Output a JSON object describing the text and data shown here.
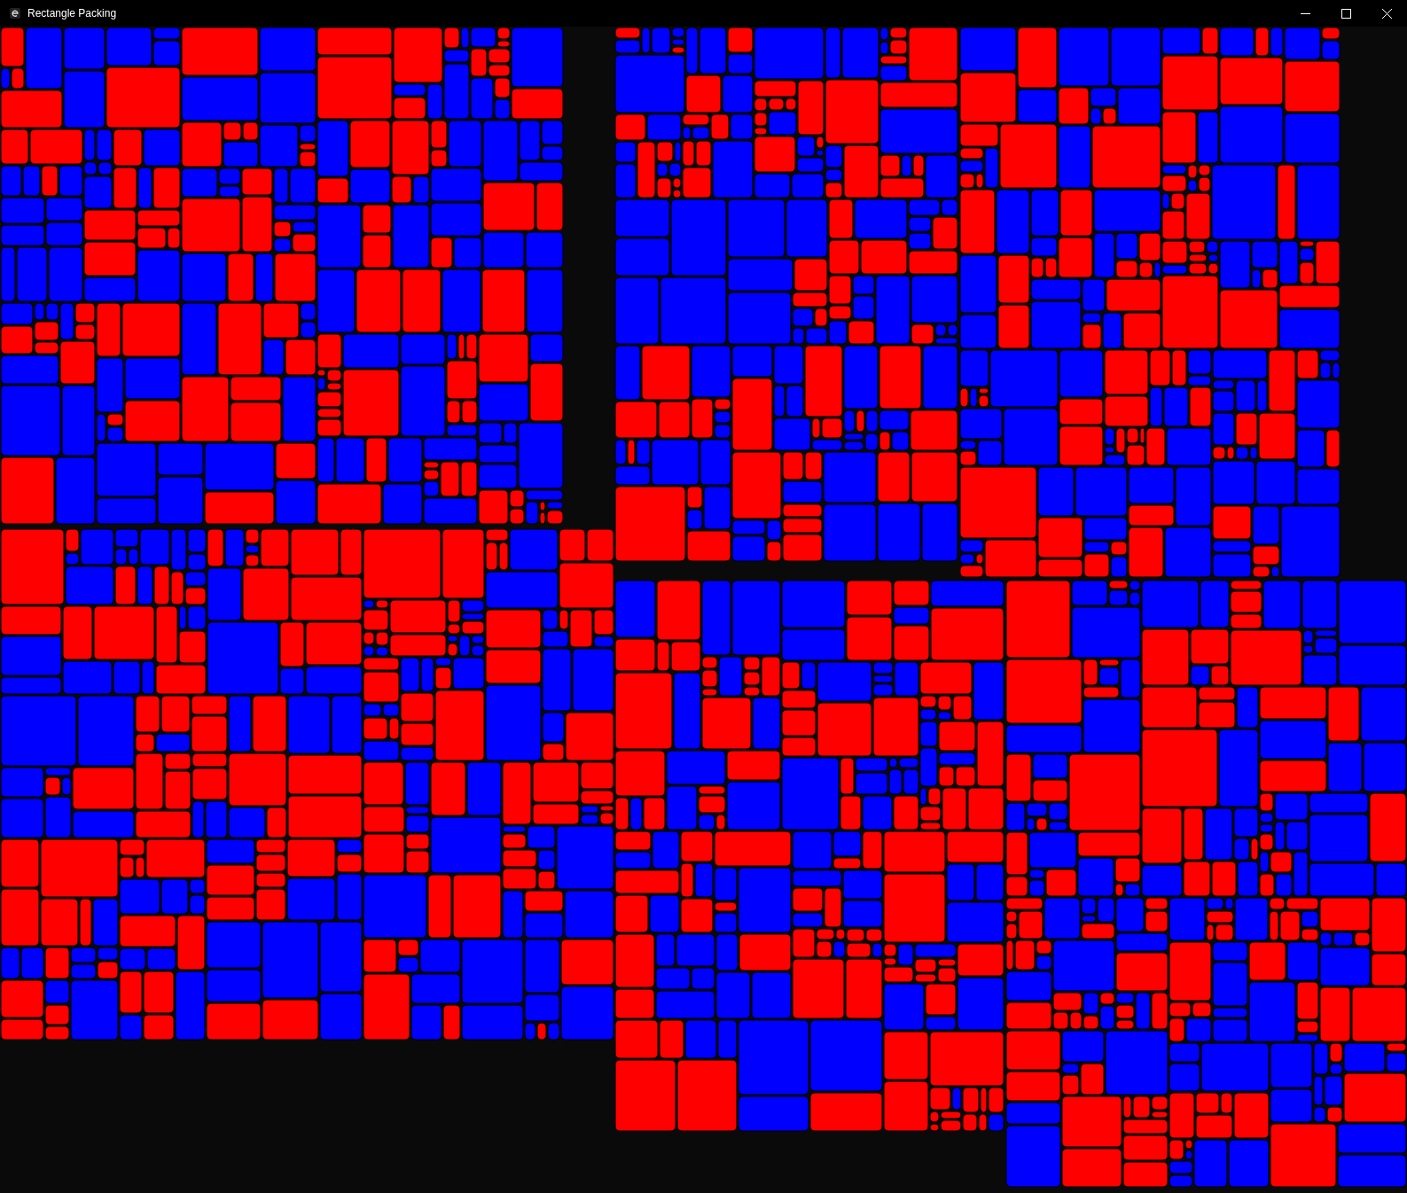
{
  "window": {
    "title": "Rectangle Packing"
  }
}
